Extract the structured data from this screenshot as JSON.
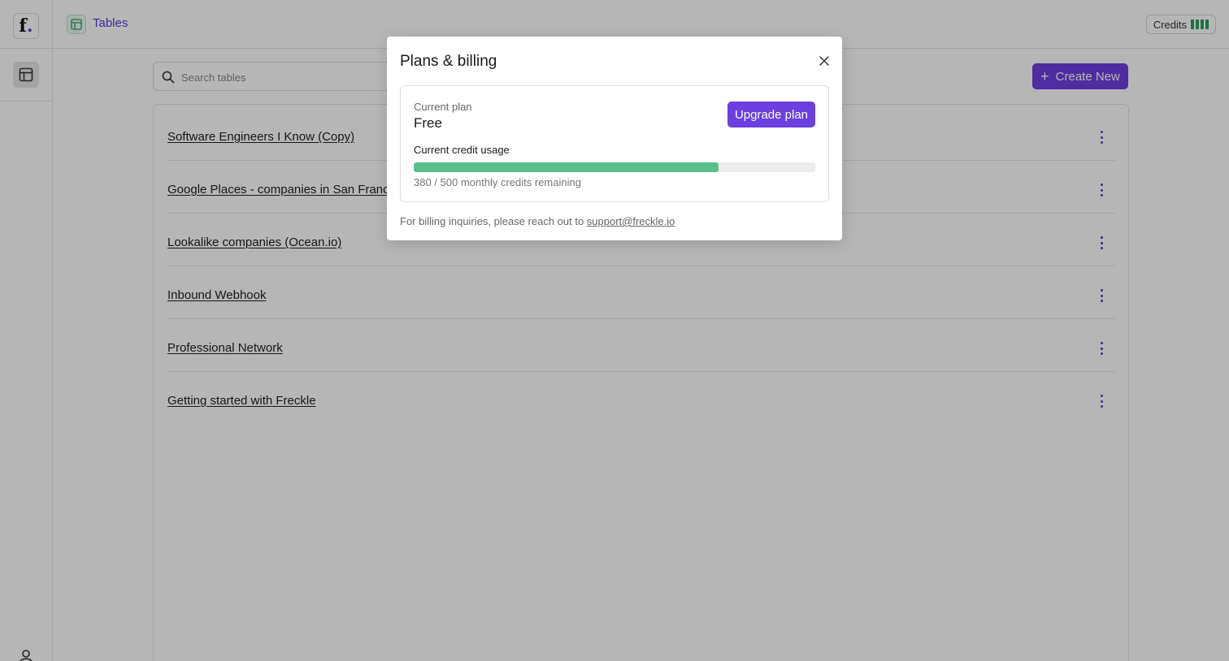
{
  "app": {
    "logo_letter": "f",
    "logo_dot": "."
  },
  "header": {
    "title": "Tables",
    "credits_label": "Credits"
  },
  "search": {
    "placeholder": "Search tables"
  },
  "toolbar": {
    "create_label": "Create New"
  },
  "tables": [
    {
      "name": "Software Engineers I Know (Copy)"
    },
    {
      "name": "Google Places - companies in San Francisco"
    },
    {
      "name": "Lookalike companies (Ocean.io)"
    },
    {
      "name": "Inbound Webhook"
    },
    {
      "name": "Professional Network"
    },
    {
      "name": "Getting started with Freckle"
    }
  ],
  "modal": {
    "title": "Plans & billing",
    "current_plan_label": "Current plan",
    "plan_name": "Free",
    "upgrade_label": "Upgrade plan",
    "usage_label": "Current credit usage",
    "credits_remaining": 380,
    "credits_total": 500,
    "usage_text": "380 / 500 monthly credits remaining",
    "billing_note": "For billing inquiries, please reach out to ",
    "support_email": "support@freckle.io"
  },
  "colors": {
    "accent": "#6c3fe0",
    "progress": "#5bbf8c",
    "credits_bars": "#2f9e63"
  }
}
